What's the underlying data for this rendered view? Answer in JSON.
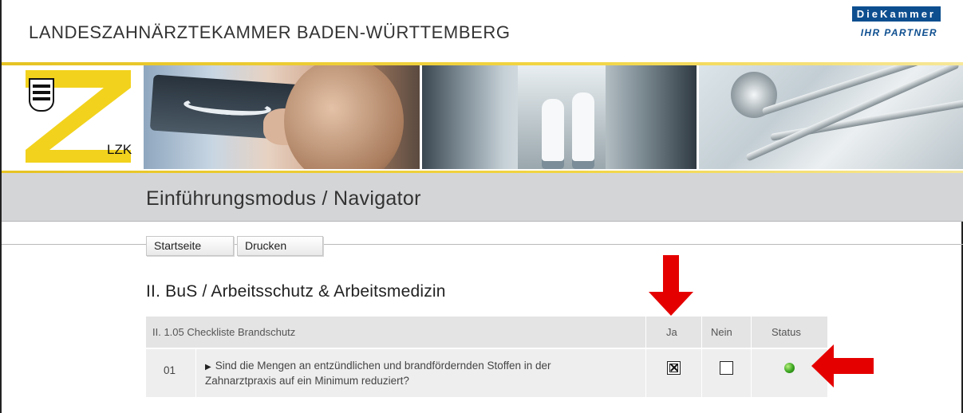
{
  "header": {
    "org_title": "LANDESZAHNÄRZTEKAMMER BADEN-WÜRTTEMBERG",
    "brand_name": "DieKammer",
    "brand_slogan": "IHR PARTNER",
    "logo_label": "LZK"
  },
  "page": {
    "title": "Einführungsmodus / Navigator"
  },
  "nav": {
    "home_label": "Startseite",
    "print_label": "Drucken"
  },
  "section": {
    "heading": "II. BuS / Arbeitsschutz & Arbeitsmedizin"
  },
  "table": {
    "columns": {
      "title": "II. 1.05 Checkliste Brandschutz",
      "yes": "Ja",
      "no": "Nein",
      "status": "Status"
    },
    "rows": [
      {
        "number": "01",
        "question": "Sind die Mengen an entzündlichen und brandfördernden Stoffen in der Zahnarztpraxis auf ein Minimum reduziert?",
        "yes_checked": true,
        "no_checked": false,
        "status_color": "#3aa520"
      }
    ]
  },
  "colors": {
    "accent_yellow": "#f2d544",
    "brand_blue": "#0d4e8f",
    "annotation_red": "#e50000",
    "band_grey": "#d4d5d7"
  },
  "icons": {
    "expand": "triangle-right-icon",
    "status": "green-dot-icon",
    "annotation_down": "red-arrow-down-icon",
    "annotation_left": "red-arrow-left-icon"
  }
}
